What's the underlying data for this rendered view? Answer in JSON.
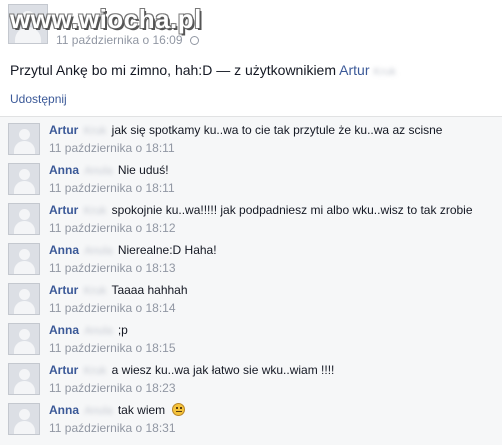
{
  "watermark": "www.wiocha.pl",
  "post": {
    "timestamp": "11 października o 16:09",
    "text": "Przytul Ankę bo mi zimno, hah:D — z użytkownikiem",
    "tagged_first_name": "Artur",
    "tagged_surname_blurred": "Kruk",
    "share_label": "Udostępnij"
  },
  "comments": [
    {
      "author": "Artur",
      "surname_blurred": "Kruk",
      "text": "jak się spotkamy ku..wa to cie tak przytule że ku..wa az scisne",
      "time": "11 października o 18:11"
    },
    {
      "author": "Anna",
      "surname_blurred": "Anula",
      "text": "Nie uduś!",
      "time": "11 października o 18:11"
    },
    {
      "author": "Artur",
      "surname_blurred": "Kruk",
      "text": "spokojnie ku..wa!!!!! jak podpadniesz mi albo wku..wisz to tak zrobie",
      "time": "11 października o 18:12"
    },
    {
      "author": "Anna",
      "surname_blurred": "Anula",
      "text": "Nierealne:D Haha!",
      "time": "11 października o 18:13"
    },
    {
      "author": "Artur",
      "surname_blurred": "Kruk",
      "text": "Taaaa hahhah",
      "time": "11 października o 18:14"
    },
    {
      "author": "Anna",
      "surname_blurred": "Anula",
      "text": ";p",
      "time": "11 października o 18:15"
    },
    {
      "author": "Artur",
      "surname_blurred": "Kruk",
      "text": "a wiesz ku..wa jak łatwo sie wku..wiam !!!!",
      "time": "11 października o 18:23"
    },
    {
      "author": "Anna",
      "surname_blurred": "Anula",
      "text": "tak wiem",
      "time": "11 października o 18:31",
      "emoticon": "smile-emoticon"
    }
  ],
  "colors": {
    "link": "#3b5998",
    "meta": "#9197a3",
    "comments_bg": "#f6f7f8"
  }
}
